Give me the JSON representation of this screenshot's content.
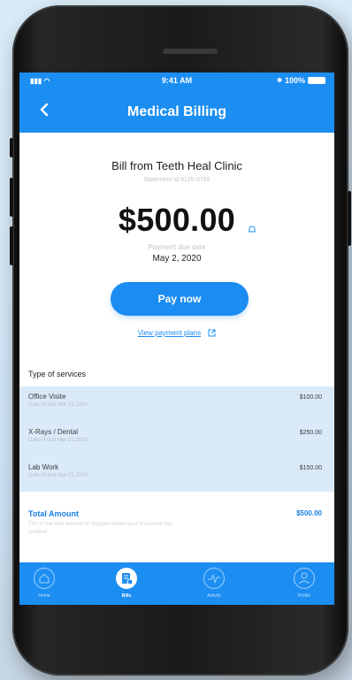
{
  "status_bar": {
    "signal": "▮▮▮ ◠",
    "time": "9:41 AM",
    "bluetooth": "✱",
    "battery_percent": "100%"
  },
  "header": {
    "title": "Medical Billing"
  },
  "bill": {
    "from": "Bill from Teeth Heal Clinic",
    "statement_id": "Statement Id #125-9765",
    "amount": "$500.00",
    "due_label": "Payment due date",
    "due_date": "May 2, 2020"
  },
  "actions": {
    "pay_label": "Pay now",
    "plans_label": "View payment plans"
  },
  "services": {
    "title": "Type of services",
    "items": [
      {
        "name": "Office Visite",
        "date": "Date of visit Mar 21,2020",
        "price": "$100.00"
      },
      {
        "name": "X-Rays / Dental",
        "date": "Date of visit Mar 21,2020",
        "price": "$250.00"
      },
      {
        "name": "Lab Work",
        "date": "Date of visit Mar 21,2020",
        "price": "$150.00"
      }
    ]
  },
  "total": {
    "label": "Total Amount",
    "amount": "$500.00",
    "note": "This is the total amount of charges before your insurance has credited"
  },
  "tabs": [
    {
      "label": "Home",
      "icon": "home-icon",
      "active": false
    },
    {
      "label": "Bills",
      "icon": "bills-icon",
      "active": true
    },
    {
      "label": "Activity",
      "icon": "activity-icon",
      "active": false
    },
    {
      "label": "Profile",
      "icon": "profile-icon",
      "active": false
    }
  ],
  "colors": {
    "primary": "#1c8ef2",
    "services_bg": "#dbeaf8",
    "total_text": "#1a7fe0"
  }
}
